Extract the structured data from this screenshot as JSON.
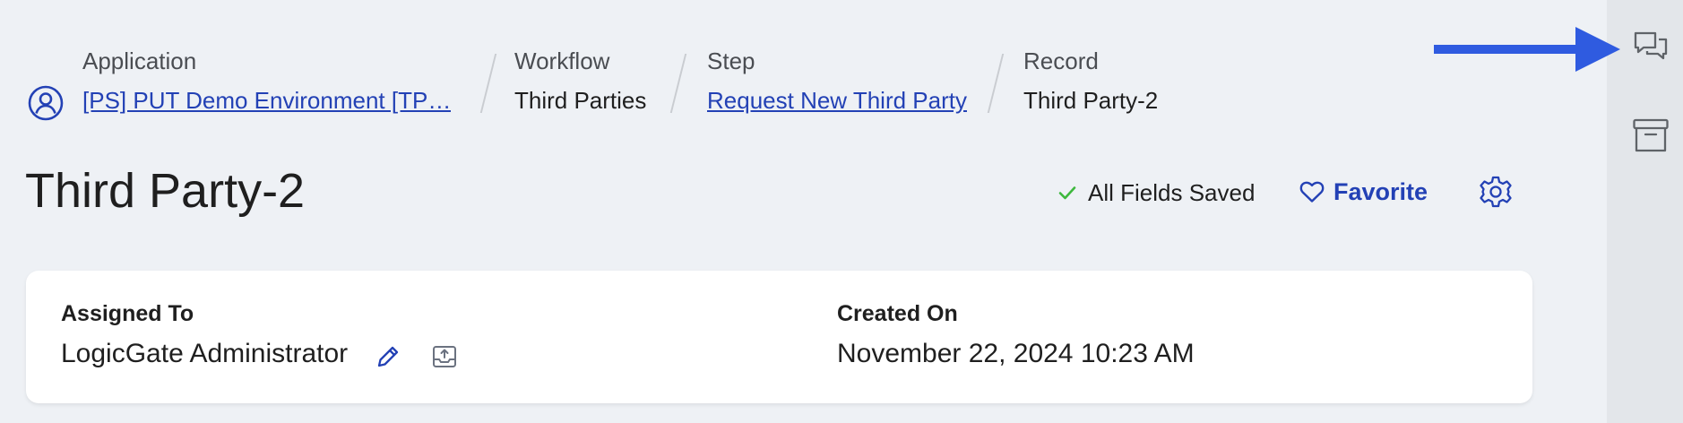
{
  "breadcrumb": {
    "application": {
      "label": "Application",
      "value": "[PS] PUT Demo Environment [TP…"
    },
    "workflow": {
      "label": "Workflow",
      "value": "Third Parties"
    },
    "step": {
      "label": "Step",
      "value": "Request New Third Party"
    },
    "record": {
      "label": "Record",
      "value": "Third Party-2"
    }
  },
  "header": {
    "title": "Third Party-2",
    "save_status": "All Fields Saved",
    "favorite_label": "Favorite"
  },
  "details": {
    "assigned_to": {
      "label": "Assigned To",
      "value": "LogicGate Administrator"
    },
    "created_on": {
      "label": "Created On",
      "value": "November 22, 2024 10:23 AM"
    }
  },
  "rail": {
    "items": [
      {
        "icon": "comments-icon"
      },
      {
        "icon": "archive-icon"
      }
    ]
  },
  "colors": {
    "link": "#2341b5",
    "success": "#3db83d",
    "background": "#eef1f5",
    "rail": "#e3e6ea",
    "annotation_arrow": "#2f5be0"
  }
}
